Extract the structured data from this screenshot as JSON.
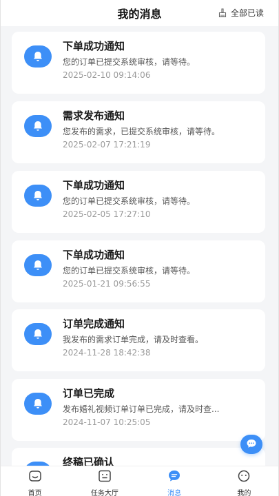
{
  "header": {
    "title": "我的消息",
    "read_all_label": "全部已读"
  },
  "colors": {
    "accent": "#3d8ff7",
    "background": "#f4f5f7"
  },
  "notifications": [
    {
      "title": "下单成功通知",
      "body": "您的订单已提交系统审核，请等待。",
      "time": "2025-02-10 09:14:06",
      "icon": "bell-icon"
    },
    {
      "title": "需求发布通知",
      "body": "您发布的需求，已提交系统审核，请等待。",
      "time": "2025-02-07 17:21:19",
      "icon": "bell-icon"
    },
    {
      "title": "下单成功通知",
      "body": "您的订单已提交系统审核，请等待。",
      "time": "2025-02-05 17:27:10",
      "icon": "bell-icon"
    },
    {
      "title": "下单成功通知",
      "body": "您的订单已提交系统审核，请等待。",
      "time": "2025-01-21 09:56:55",
      "icon": "bell-icon"
    },
    {
      "title": "订单完成通知",
      "body": "我发布的需求订单完成，请及时查看。",
      "time": "2024-11-28 18:42:38",
      "icon": "bell-icon"
    },
    {
      "title": "订单已完成",
      "body": "发布婚礼视频订单订单已完成，请及时查...",
      "time": "2024-11-07 10:25:05",
      "icon": "bell-icon"
    },
    {
      "title": "终稿已确认",
      "body": "",
      "time": "",
      "icon": "bell-icon"
    }
  ],
  "tabbar": {
    "items": [
      {
        "label": "首页",
        "icon": "home-icon",
        "active": false
      },
      {
        "label": "任务大厅",
        "icon": "task-hall-icon",
        "active": false
      },
      {
        "label": "消息",
        "icon": "message-icon",
        "active": true
      },
      {
        "label": "我的",
        "icon": "profile-icon",
        "active": false
      }
    ]
  }
}
